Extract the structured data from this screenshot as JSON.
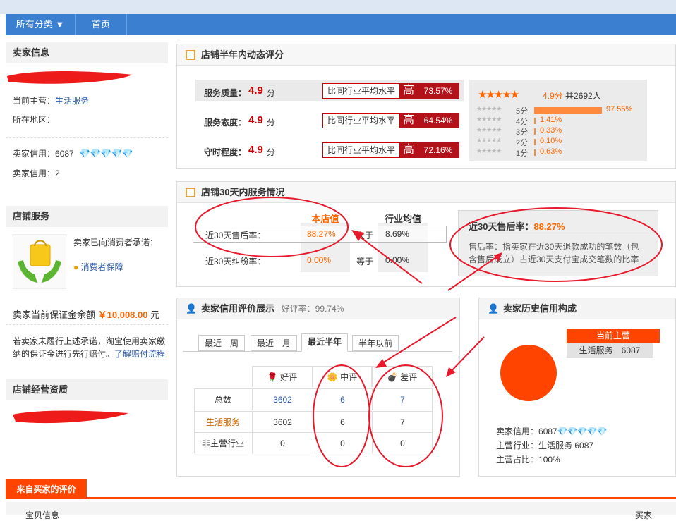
{
  "nav": {
    "all_categories": "所有分类",
    "home": "首页"
  },
  "seller_info": {
    "title": "卖家信息",
    "main_business_label": "当前主营：",
    "main_business_value": "生活服务",
    "location_label": "所在地区：",
    "credit_label_1": "卖家信用：",
    "credit_value_1": "6087",
    "credit_label_2": "卖家信用：",
    "credit_value_2": "2"
  },
  "shop_service": {
    "title": "店铺服务",
    "promise_text": "卖家已向消费者承诺：",
    "guarantee_link": "消费者保障",
    "deposit_label": "卖家当前保证金余额",
    "deposit_value": "￥10,008.00",
    "deposit_unit": "元",
    "note_line1": "若卖家未履行上述承诺，淘宝使用卖家缴",
    "note_line2": "纳的保证金进行先行赔付。",
    "note_link": "了解赔付流程"
  },
  "qualification": {
    "title": "店铺经营资质"
  },
  "dynamic_rating": {
    "title": "店铺半年内动态评分",
    "rows": [
      {
        "label": "服务质量：",
        "score": "4.9",
        "unit": "分",
        "compare": "比同行业平均水平",
        "level": "高",
        "pct": "73.57%"
      },
      {
        "label": "服务态度：",
        "score": "4.9",
        "unit": "分",
        "compare": "比同行业平均水平",
        "level": "高",
        "pct": "64.54%"
      },
      {
        "label": "守时程度：",
        "score": "4.9",
        "unit": "分",
        "compare": "比同行业平均水平",
        "level": "高",
        "pct": "72.16%"
      }
    ],
    "summary_score": "4.9分",
    "summary_count": "共2692人",
    "dist": [
      {
        "label": "5分",
        "pct": "97.55%",
        "fraction": 0.9755
      },
      {
        "label": "4分",
        "pct": "1.41%",
        "fraction": 0.0141
      },
      {
        "label": "3分",
        "pct": "0.33%",
        "fraction": 0.0033
      },
      {
        "label": "2分",
        "pct": "0.10%",
        "fraction": 0.001
      },
      {
        "label": "1分",
        "pct": "0.63%",
        "fraction": 0.0063
      }
    ]
  },
  "service30": {
    "title": "店铺30天内服务情况",
    "col_shop": "本店值",
    "col_industry": "行业均值",
    "rows": [
      {
        "label": "近30天售后率：",
        "shop": "88.27%",
        "cmp": "大于",
        "industry": "8.69%"
      },
      {
        "label": "近30天纠纷率：",
        "shop": "0.00%",
        "cmp": "等于",
        "industry": "0.00%"
      }
    ],
    "tip_title": "近30天售后率：",
    "tip_value": "88.27%",
    "tip_desc_1": "售后率：指卖家在近30天退款成功的笔数（包",
    "tip_desc_2": "含售后成立）占近30天支付宝成交笔数的比率"
  },
  "credit_display": {
    "title": "卖家信用评价展示",
    "good_rate": "好评率：99.74%",
    "tabs": [
      "最近一周",
      "最近一月",
      "最近半年",
      "半年以前"
    ],
    "active_tab": 2,
    "headers": [
      "好评",
      "中评",
      "差评"
    ],
    "rows": [
      {
        "label": "总数",
        "values": [
          "3602",
          "6",
          "7"
        ]
      },
      {
        "label": "生活服务",
        "values": [
          "3602",
          "6",
          "7"
        ]
      },
      {
        "label": "非主营行业",
        "values": [
          "0",
          "0",
          "0"
        ]
      }
    ]
  },
  "history_credit": {
    "title": "卖家历史信用构成",
    "tag_title": "当前主营",
    "tag_value": "生活服务　6087",
    "credit_label": "卖家信用：",
    "credit_value": "6087",
    "industry_label": "主营行业：",
    "industry_value": "生活服务 6087",
    "ratio_label": "主营占比：",
    "ratio_value": "100%"
  },
  "reviews": {
    "title": "来自买家的评价",
    "sub_left": "宝贝信息",
    "sub_right": "买家"
  },
  "colors": {
    "nav": "#3a7fd0",
    "accent": "#ff4400",
    "annotation": "#e8192c",
    "high_badge": "#b3121a"
  }
}
